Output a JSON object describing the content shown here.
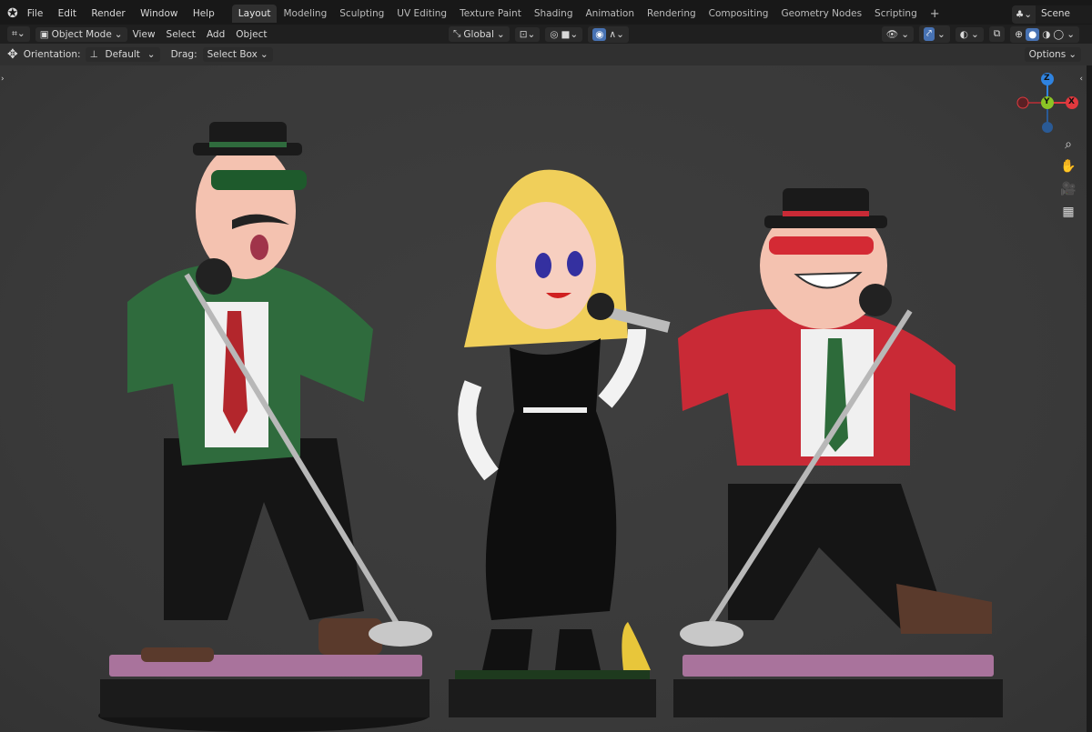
{
  "menu": [
    "File",
    "Edit",
    "Render",
    "Window",
    "Help"
  ],
  "workspaces": [
    "Layout",
    "Modeling",
    "Sculpting",
    "UV Editing",
    "Texture Paint",
    "Shading",
    "Animation",
    "Rendering",
    "Compositing",
    "Geometry Nodes",
    "Scripting"
  ],
  "active_workspace": "Layout",
  "add_workspace": "+",
  "scene": "Scene",
  "header": {
    "mode": "Object Mode",
    "view": "View",
    "select": "Select",
    "add": "Add",
    "object": "Object",
    "transform_orientation": "Global"
  },
  "tool_settings": {
    "orientation_label": "Orientation:",
    "orientation_value": "Default",
    "drag_label": "Drag:",
    "drag_value": "Select Box",
    "options": "Options"
  },
  "gizmo": {
    "z": "Z",
    "y": "Y",
    "x": "X"
  },
  "colors": {
    "accent": "#4772b3",
    "gizmo_x": "#e0393e",
    "gizmo_y": "#8bc425",
    "gizmo_z": "#2f83e0"
  }
}
